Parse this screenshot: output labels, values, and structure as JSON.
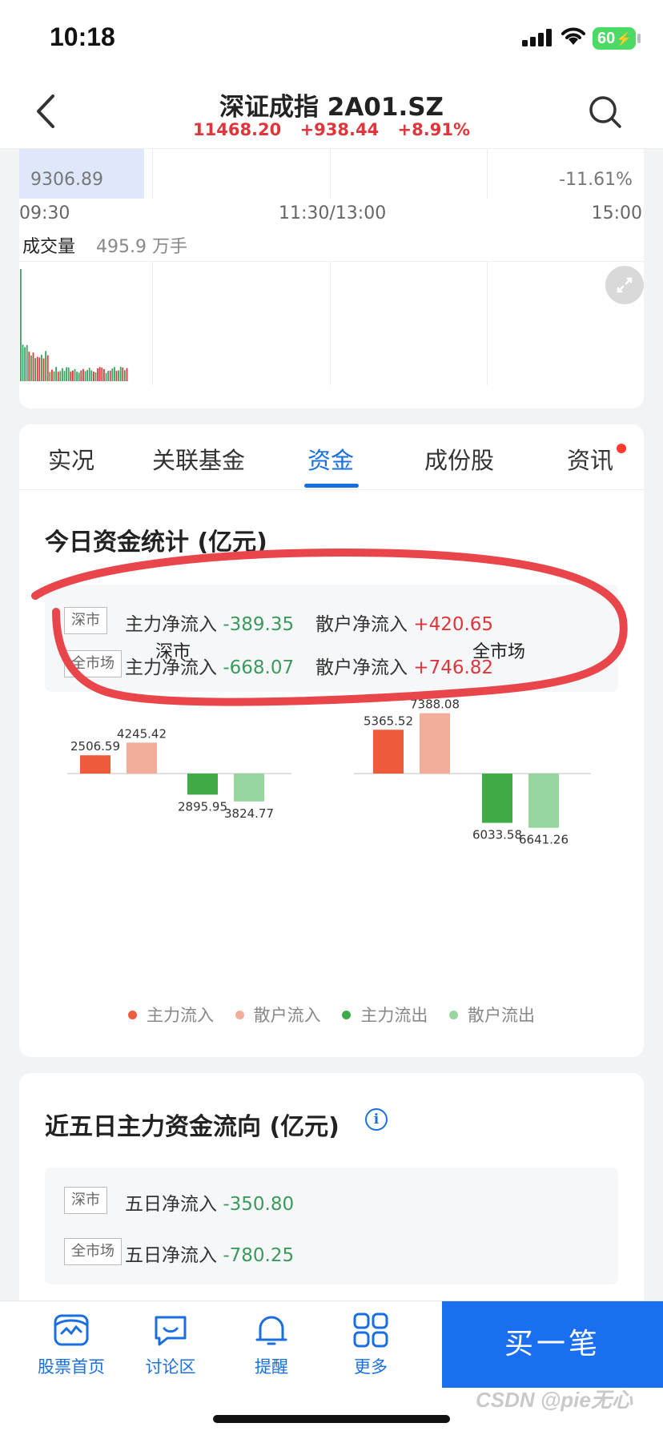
{
  "status_bar": {
    "time": "10:18",
    "battery": "60"
  },
  "header": {
    "title": "深证成指 2A01.SZ",
    "price": "11468.20",
    "change": "+938.44",
    "change_pct": "+8.91%"
  },
  "intraday": {
    "low_value": "9306.89",
    "low_pct": "-11.61%",
    "times": [
      "09:30",
      "11:30/13:00",
      "15:00"
    ],
    "volume_label": "成交量",
    "volume_value": "495.9 万手"
  },
  "tabs": [
    {
      "label": "实况"
    },
    {
      "label": "关联基金"
    },
    {
      "label": "资金",
      "active": true
    },
    {
      "label": "成份股"
    },
    {
      "label": "资讯",
      "badge": true
    }
  ],
  "today": {
    "title": "今日资金统计 (亿元)",
    "rows": [
      {
        "tag": "深市",
        "main_label": "主力净流入",
        "main_value": "-389.35",
        "retail_label": "散户净流入",
        "retail_value": "+420.65"
      },
      {
        "tag": "全市场",
        "main_label": "主力净流入",
        "main_value": "-668.07",
        "retail_label": "散户净流入",
        "retail_value": "+746.82"
      }
    ]
  },
  "chart_data": [
    {
      "type": "bar",
      "title": "深市",
      "categories": [
        "主力流入",
        "散户流入",
        "主力流出",
        "散户流出"
      ],
      "values": [
        2506.59,
        4245.42,
        -2895.95,
        -3824.77
      ],
      "labels": [
        "2506.59",
        "4245.42",
        "2895.95",
        "3824.77"
      ],
      "colors": [
        "#ee5a3c",
        "#f3ae9b",
        "#3faa48",
        "#98d6a0"
      ]
    },
    {
      "type": "bar",
      "title": "全市场",
      "categories": [
        "主力流入",
        "散户流入",
        "主力流出",
        "散户流出"
      ],
      "values": [
        5365.52,
        7388.08,
        -6033.58,
        -6641.26
      ],
      "labels": [
        "5365.52",
        "7388.08",
        "6033.58",
        "6641.26"
      ],
      "colors": [
        "#ee5a3c",
        "#f3ae9b",
        "#3faa48",
        "#98d6a0"
      ]
    }
  ],
  "legend": [
    {
      "label": "主力流入",
      "color": "#ee5a3c"
    },
    {
      "label": "散户流入",
      "color": "#f3ae9b"
    },
    {
      "label": "主力流出",
      "color": "#3faa48"
    },
    {
      "label": "散户流出",
      "color": "#98d6a0"
    }
  ],
  "five_day": {
    "title": "近五日主力资金流向 (亿元)",
    "info_icon": "i",
    "rows": [
      {
        "tag": "深市",
        "label": "五日净流入",
        "value": "-350.80"
      },
      {
        "tag": "全市场",
        "label": "五日净流入",
        "value": "-780.25"
      }
    ]
  },
  "bottom_nav": [
    {
      "label": "股票首页",
      "icon": "stock-home-icon"
    },
    {
      "label": "讨论区",
      "icon": "chat-icon"
    },
    {
      "label": "提醒",
      "icon": "bell-icon"
    },
    {
      "label": "更多",
      "icon": "grid-icon"
    }
  ],
  "buy_button": "买一笔",
  "watermark": "CSDN @pie无心",
  "colors": {
    "accent": "#1a6fe0",
    "up": "#e0353b",
    "down": "#3a9a5c",
    "annotation": "#e8464b"
  }
}
